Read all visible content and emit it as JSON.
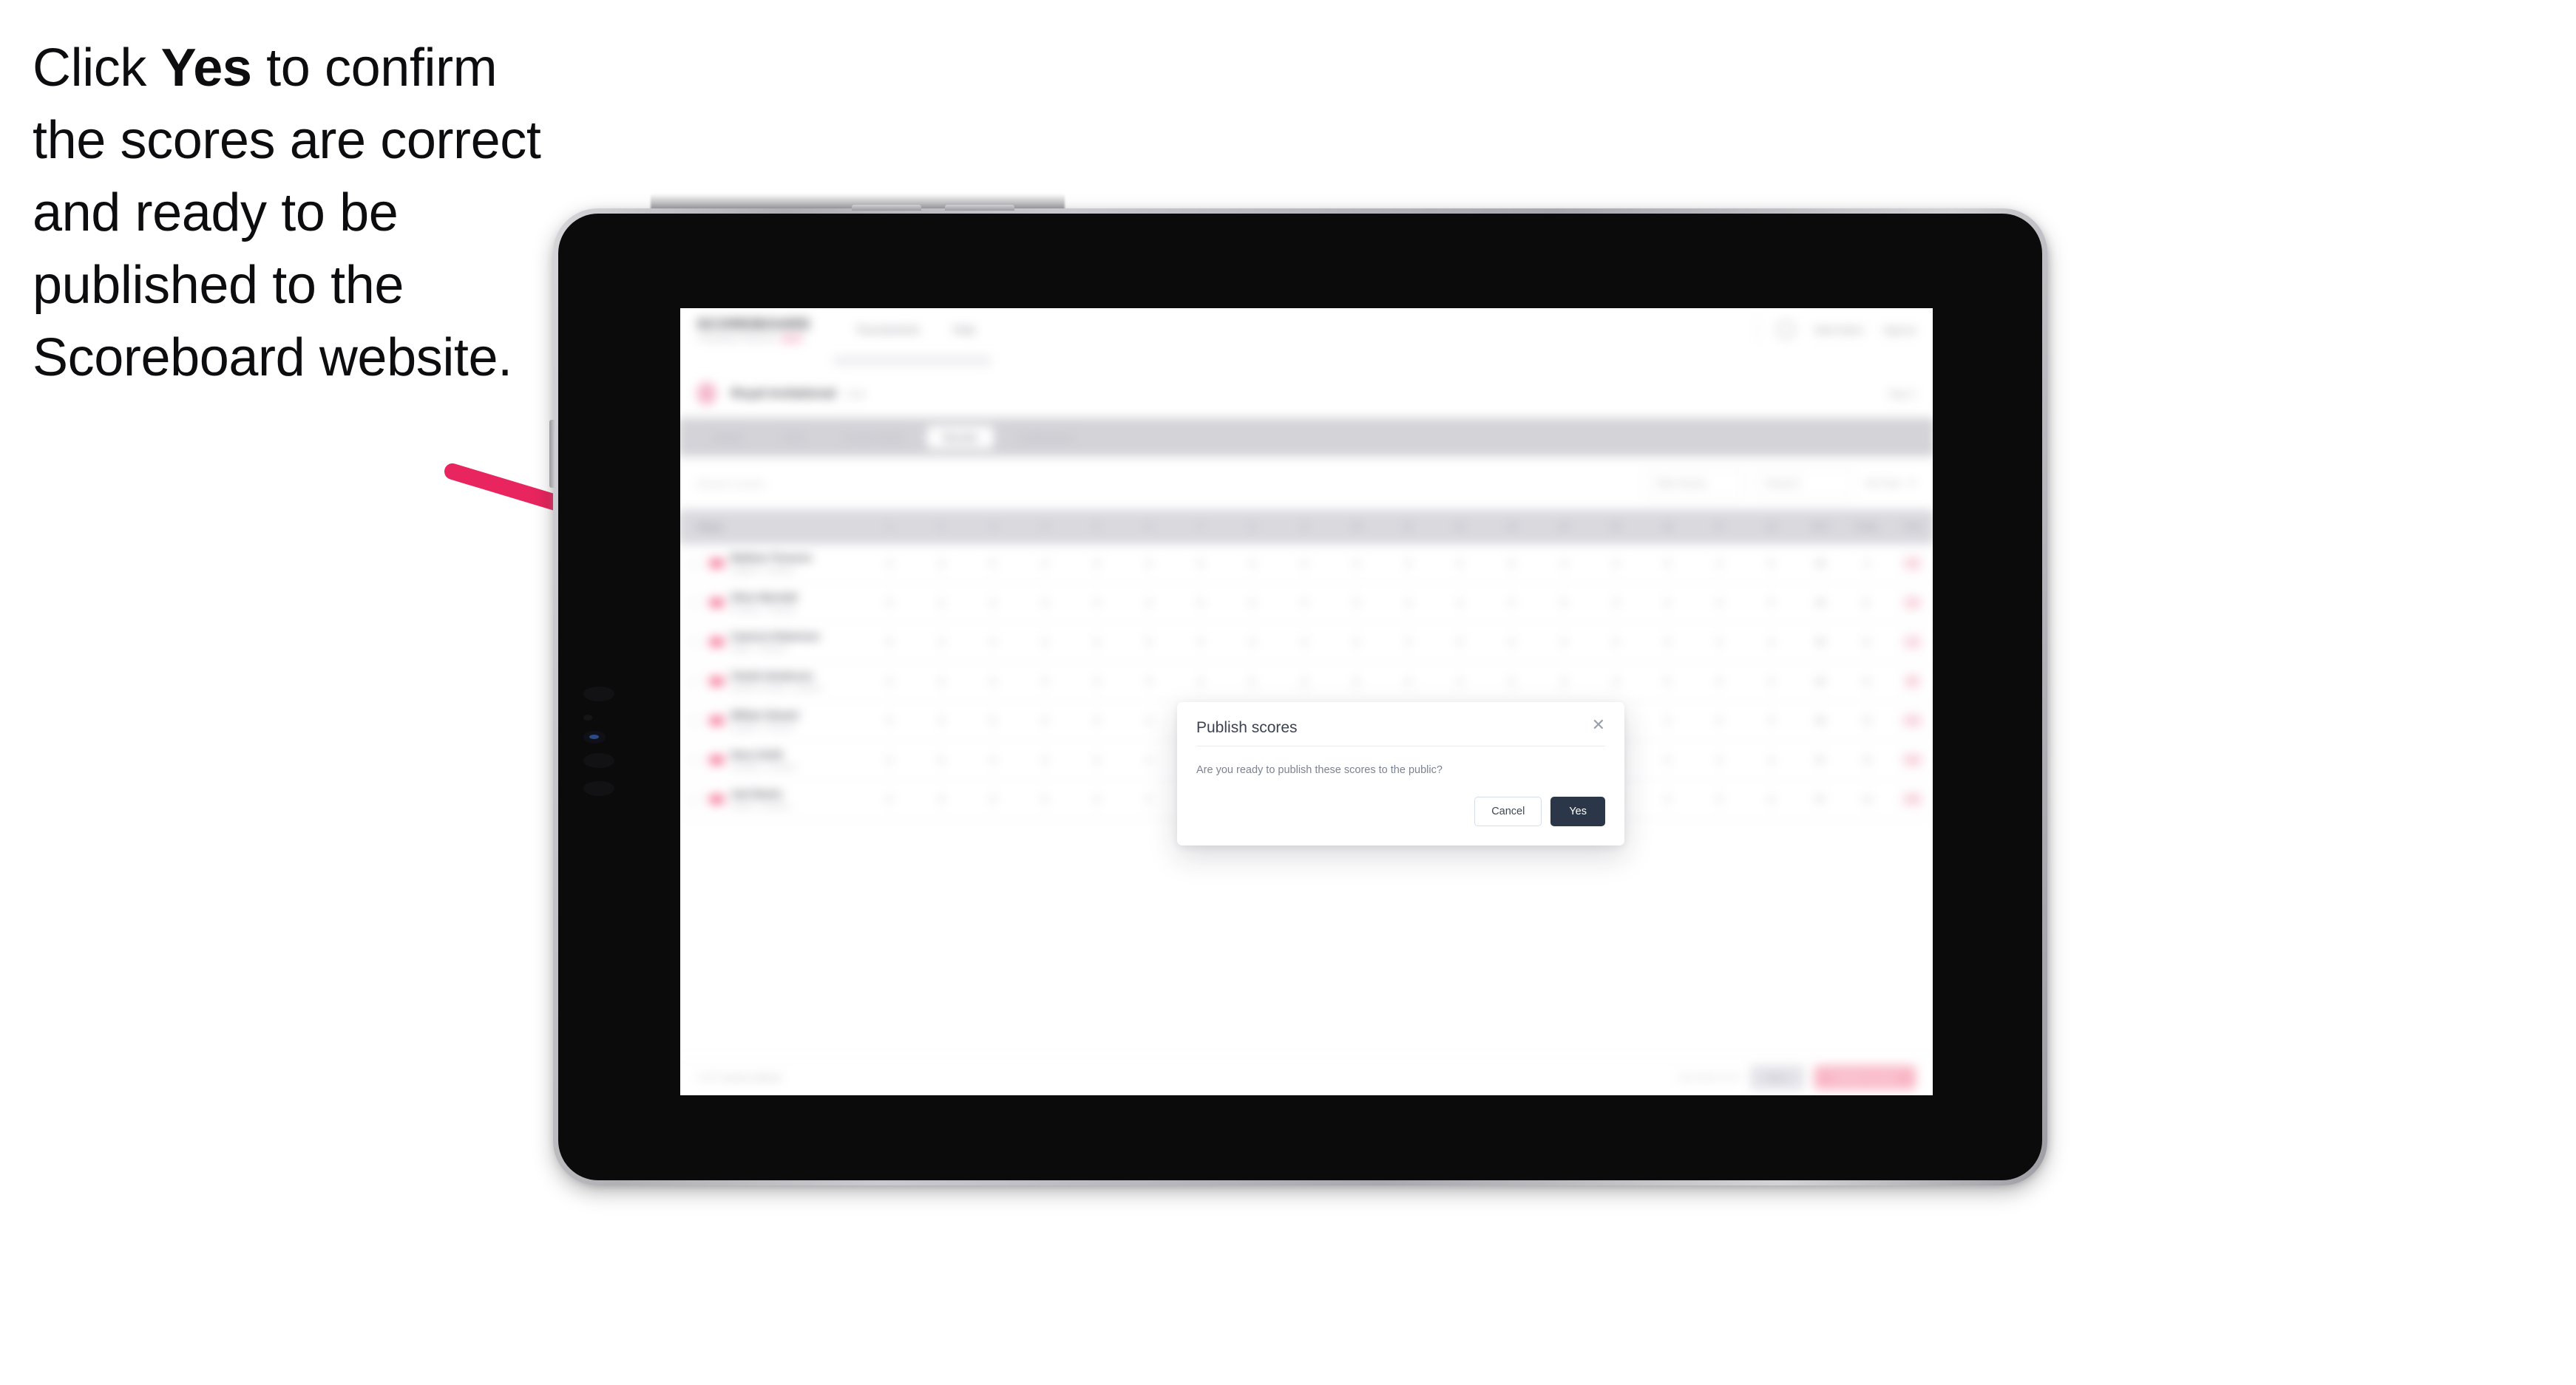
{
  "caption": {
    "line_prefix": "Click ",
    "emphasis": "Yes",
    "line_rest": " to confirm the scores are correct and ready to be published to the Scoreboard website."
  },
  "annotation": {
    "arrow_color": "#E8255E",
    "arrow_start": "615,640",
    "arrow_end": "1385,872"
  },
  "device": {
    "type": "tablet",
    "frame_color": "#0b0b0c",
    "bezel_color": "#c9c9cf"
  },
  "app": {
    "logo": {
      "text": "SCOREBOARD",
      "sub": "TOURNAMENT MANAGER"
    },
    "nav_links": [
      "Tournaments",
      "Help"
    ],
    "nav_right": [
      "Matt Dalton",
      "Signout"
    ],
    "breadcrumb": "Tournaments / Royal Invitational",
    "tournament": {
      "name": "Royal Invitational",
      "status": "Live",
      "meta": "Day 2"
    },
    "tabs": [
      {
        "label": "Details",
        "active": false
      },
      {
        "label": "Field",
        "active": false
      },
      {
        "label": "Course Setup",
        "active": false
      },
      {
        "label": "Results",
        "active": true
      },
      {
        "label": "Leaderboard",
        "active": false
      }
    ],
    "toolbar": {
      "left_label": "Round 2 scores",
      "filter": "Filter Scores",
      "round": "Round 2",
      "tee": "Tee Time",
      "caret_icon": "chevron-down-icon"
    },
    "table": {
      "player_header": "Player",
      "hole_headers": [
        "1",
        "2",
        "3",
        "4",
        "5",
        "6",
        "7",
        "8",
        "9",
        "10",
        "11",
        "12",
        "13",
        "14",
        "15",
        "16",
        "17",
        "18"
      ],
      "total_headers": [
        "OUT",
        "Today",
        "Total"
      ],
      "rows": [
        {
          "name": "Matthew Thomson",
          "sub": "England · Amateur",
          "scores": [
            "4",
            "3",
            "5",
            "4",
            "3",
            "4",
            "5",
            "4",
            "4",
            "4",
            "3",
            "4",
            "5",
            "4",
            "3",
            "4",
            "4",
            "5"
          ],
          "out": "36",
          "today": "-1",
          "total": "-3",
          "chip": "-3"
        },
        {
          "name": "Oliver Marshall",
          "sub": "Scotland · Amateur",
          "scores": [
            "4",
            "4",
            "4",
            "3",
            "4",
            "4",
            "5",
            "4",
            "4",
            "3",
            "4",
            "4",
            "4",
            "5",
            "3",
            "4",
            "4",
            "4"
          ],
          "out": "36",
          "today": "E",
          "total": "-2",
          "chip": "-2"
        },
        {
          "name": "Cameron Robertson",
          "sub": "Wales · Amateur",
          "scores": [
            "5",
            "3",
            "4",
            "4",
            "3",
            "5",
            "4",
            "4",
            "4",
            "4",
            "3",
            "5",
            "4",
            "4",
            "4",
            "3",
            "4",
            "4"
          ],
          "out": "36",
          "today": "+1",
          "total": "-1",
          "chip": "-1"
        },
        {
          "name": "Charlie Henderson",
          "sub": "Northern Ireland · Amateur",
          "scores": [
            "4",
            "4",
            "4",
            "4",
            "4",
            "4",
            "4",
            "5",
            "3",
            "4",
            "4",
            "4",
            "4",
            "4",
            "3",
            "5",
            "4",
            "4"
          ],
          "out": "36",
          "today": "+1",
          "total": "E",
          "chip": "E"
        },
        {
          "name": "William Stewart",
          "sub": "England · Amateur",
          "scores": [
            "4",
            "4",
            "5",
            "3",
            "4",
            "4",
            "4",
            "4",
            "4",
            "4",
            "4",
            "3",
            "5",
            "4",
            "4",
            "4",
            "4",
            "4"
          ],
          "out": "36",
          "today": "+2",
          "total": "+1",
          "chip": "+1"
        },
        {
          "name": "Harry Smith",
          "sub": "Scotland · Amateur",
          "scores": [
            "4",
            "5",
            "4",
            "4",
            "3",
            "4",
            "4",
            "4",
            "5",
            "4",
            "4",
            "4",
            "4",
            "3",
            "4",
            "5",
            "4",
            "4"
          ],
          "out": "37",
          "today": "+2",
          "total": "+2",
          "chip": "+2"
        },
        {
          "name": "Jack Baxter",
          "sub": "Ireland · Amateur",
          "scores": [
            "4",
            "4",
            "4",
            "5",
            "4",
            "3",
            "4",
            "5",
            "4",
            "4",
            "4",
            "4",
            "4",
            "4",
            "4",
            "4",
            "3",
            "5"
          ],
          "out": "37",
          "today": "+3",
          "total": "+3",
          "chip": "+3"
        }
      ]
    },
    "footer": {
      "left": "7 of 7 scores entered",
      "note": "Last saved 12:42",
      "secondary_button": "Save",
      "primary_button": "Publish scores"
    }
  },
  "modal": {
    "title": "Publish scores",
    "close_icon": "close-icon",
    "body": "Are you ready to publish these scores to the public?",
    "cancel_label": "Cancel",
    "confirm_label": "Yes",
    "confirm_color": "#2b3749"
  }
}
